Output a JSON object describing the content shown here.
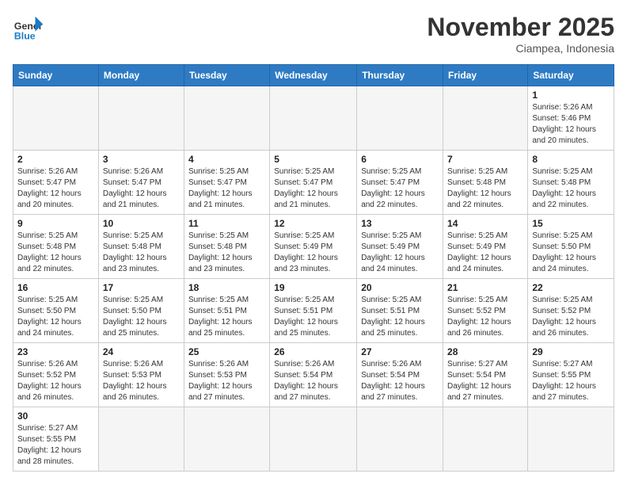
{
  "header": {
    "logo_general": "General",
    "logo_blue": "Blue",
    "month_title": "November 2025",
    "subtitle": "Ciampea, Indonesia"
  },
  "days_of_week": [
    "Sunday",
    "Monday",
    "Tuesday",
    "Wednesday",
    "Thursday",
    "Friday",
    "Saturday"
  ],
  "weeks": [
    [
      {
        "day": "",
        "info": ""
      },
      {
        "day": "",
        "info": ""
      },
      {
        "day": "",
        "info": ""
      },
      {
        "day": "",
        "info": ""
      },
      {
        "day": "",
        "info": ""
      },
      {
        "day": "",
        "info": ""
      },
      {
        "day": "1",
        "info": "Sunrise: 5:26 AM\nSunset: 5:46 PM\nDaylight: 12 hours\nand 20 minutes."
      }
    ],
    [
      {
        "day": "2",
        "info": "Sunrise: 5:26 AM\nSunset: 5:47 PM\nDaylight: 12 hours\nand 20 minutes."
      },
      {
        "day": "3",
        "info": "Sunrise: 5:26 AM\nSunset: 5:47 PM\nDaylight: 12 hours\nand 21 minutes."
      },
      {
        "day": "4",
        "info": "Sunrise: 5:25 AM\nSunset: 5:47 PM\nDaylight: 12 hours\nand 21 minutes."
      },
      {
        "day": "5",
        "info": "Sunrise: 5:25 AM\nSunset: 5:47 PM\nDaylight: 12 hours\nand 21 minutes."
      },
      {
        "day": "6",
        "info": "Sunrise: 5:25 AM\nSunset: 5:47 PM\nDaylight: 12 hours\nand 22 minutes."
      },
      {
        "day": "7",
        "info": "Sunrise: 5:25 AM\nSunset: 5:48 PM\nDaylight: 12 hours\nand 22 minutes."
      },
      {
        "day": "8",
        "info": "Sunrise: 5:25 AM\nSunset: 5:48 PM\nDaylight: 12 hours\nand 22 minutes."
      }
    ],
    [
      {
        "day": "9",
        "info": "Sunrise: 5:25 AM\nSunset: 5:48 PM\nDaylight: 12 hours\nand 22 minutes."
      },
      {
        "day": "10",
        "info": "Sunrise: 5:25 AM\nSunset: 5:48 PM\nDaylight: 12 hours\nand 23 minutes."
      },
      {
        "day": "11",
        "info": "Sunrise: 5:25 AM\nSunset: 5:48 PM\nDaylight: 12 hours\nand 23 minutes."
      },
      {
        "day": "12",
        "info": "Sunrise: 5:25 AM\nSunset: 5:49 PM\nDaylight: 12 hours\nand 23 minutes."
      },
      {
        "day": "13",
        "info": "Sunrise: 5:25 AM\nSunset: 5:49 PM\nDaylight: 12 hours\nand 24 minutes."
      },
      {
        "day": "14",
        "info": "Sunrise: 5:25 AM\nSunset: 5:49 PM\nDaylight: 12 hours\nand 24 minutes."
      },
      {
        "day": "15",
        "info": "Sunrise: 5:25 AM\nSunset: 5:50 PM\nDaylight: 12 hours\nand 24 minutes."
      }
    ],
    [
      {
        "day": "16",
        "info": "Sunrise: 5:25 AM\nSunset: 5:50 PM\nDaylight: 12 hours\nand 24 minutes."
      },
      {
        "day": "17",
        "info": "Sunrise: 5:25 AM\nSunset: 5:50 PM\nDaylight: 12 hours\nand 25 minutes."
      },
      {
        "day": "18",
        "info": "Sunrise: 5:25 AM\nSunset: 5:51 PM\nDaylight: 12 hours\nand 25 minutes."
      },
      {
        "day": "19",
        "info": "Sunrise: 5:25 AM\nSunset: 5:51 PM\nDaylight: 12 hours\nand 25 minutes."
      },
      {
        "day": "20",
        "info": "Sunrise: 5:25 AM\nSunset: 5:51 PM\nDaylight: 12 hours\nand 25 minutes."
      },
      {
        "day": "21",
        "info": "Sunrise: 5:25 AM\nSunset: 5:52 PM\nDaylight: 12 hours\nand 26 minutes."
      },
      {
        "day": "22",
        "info": "Sunrise: 5:25 AM\nSunset: 5:52 PM\nDaylight: 12 hours\nand 26 minutes."
      }
    ],
    [
      {
        "day": "23",
        "info": "Sunrise: 5:26 AM\nSunset: 5:52 PM\nDaylight: 12 hours\nand 26 minutes."
      },
      {
        "day": "24",
        "info": "Sunrise: 5:26 AM\nSunset: 5:53 PM\nDaylight: 12 hours\nand 26 minutes."
      },
      {
        "day": "25",
        "info": "Sunrise: 5:26 AM\nSunset: 5:53 PM\nDaylight: 12 hours\nand 27 minutes."
      },
      {
        "day": "26",
        "info": "Sunrise: 5:26 AM\nSunset: 5:54 PM\nDaylight: 12 hours\nand 27 minutes."
      },
      {
        "day": "27",
        "info": "Sunrise: 5:26 AM\nSunset: 5:54 PM\nDaylight: 12 hours\nand 27 minutes."
      },
      {
        "day": "28",
        "info": "Sunrise: 5:27 AM\nSunset: 5:54 PM\nDaylight: 12 hours\nand 27 minutes."
      },
      {
        "day": "29",
        "info": "Sunrise: 5:27 AM\nSunset: 5:55 PM\nDaylight: 12 hours\nand 27 minutes."
      }
    ],
    [
      {
        "day": "30",
        "info": "Sunrise: 5:27 AM\nSunset: 5:55 PM\nDaylight: 12 hours\nand 28 minutes."
      },
      {
        "day": "",
        "info": ""
      },
      {
        "day": "",
        "info": ""
      },
      {
        "day": "",
        "info": ""
      },
      {
        "day": "",
        "info": ""
      },
      {
        "day": "",
        "info": ""
      },
      {
        "day": "",
        "info": ""
      }
    ]
  ]
}
